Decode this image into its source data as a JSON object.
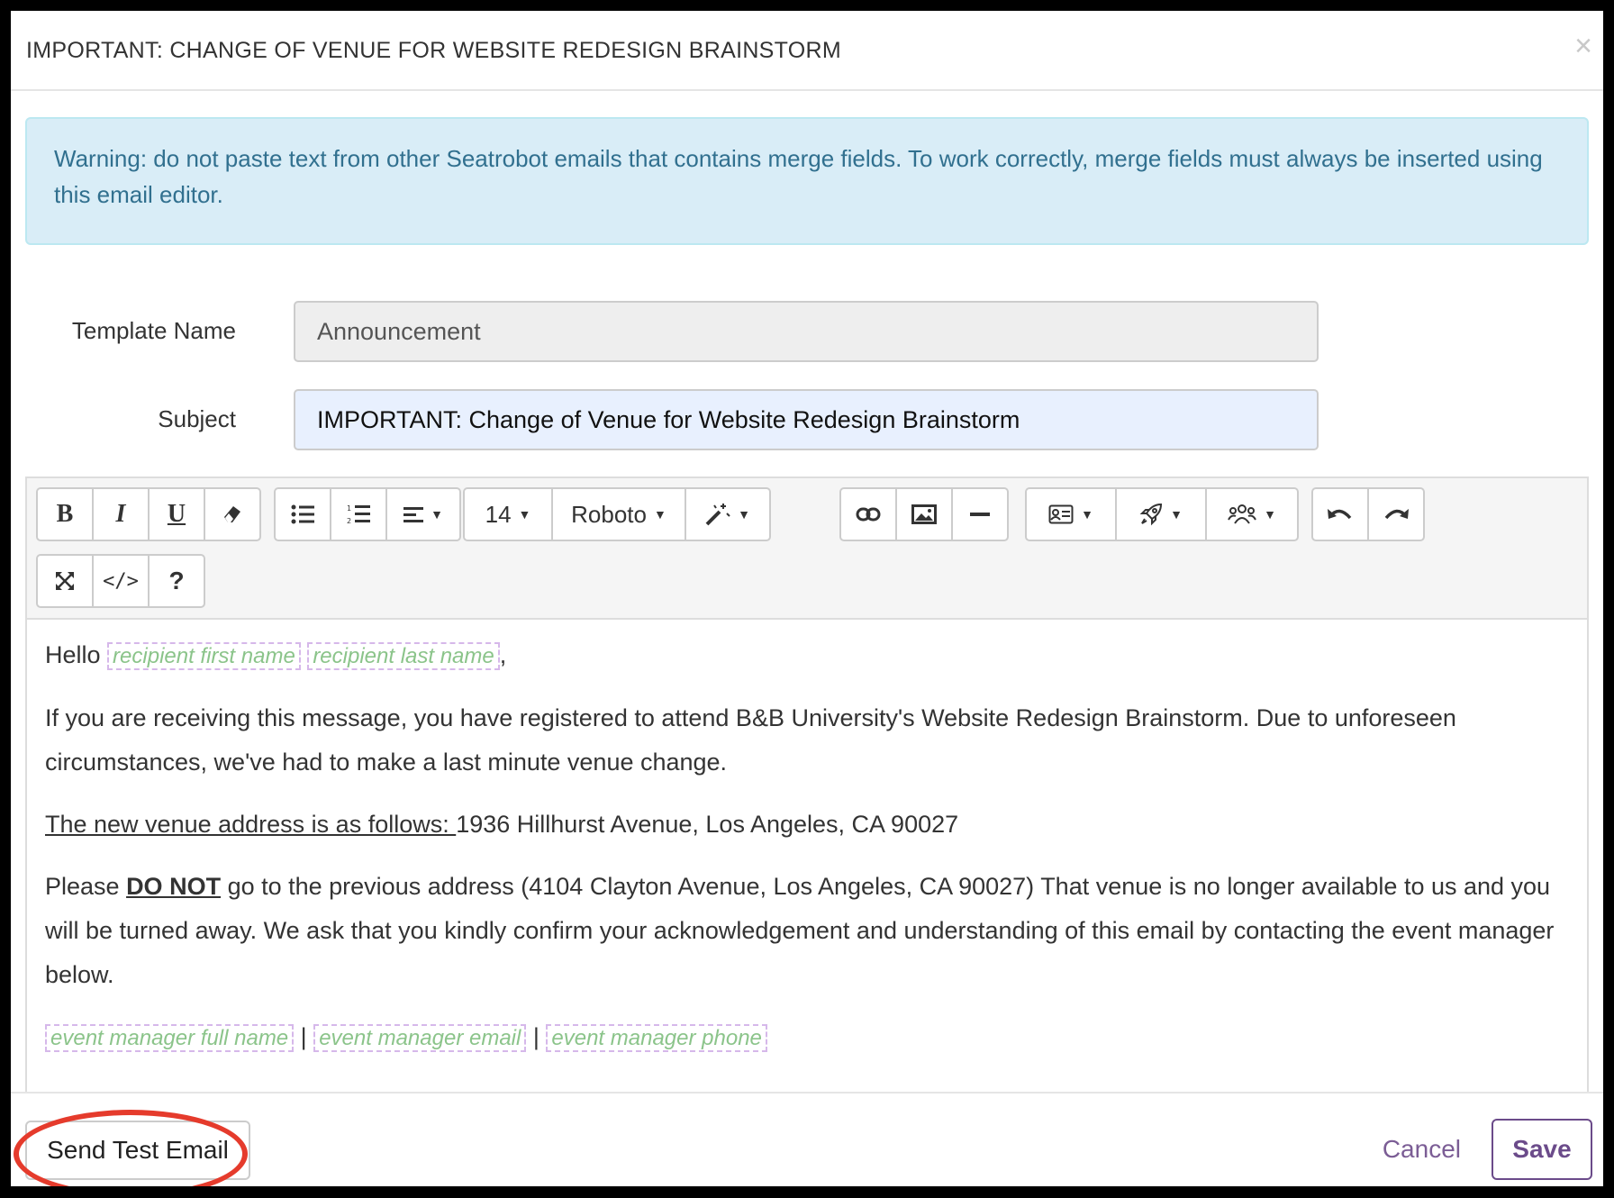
{
  "modal": {
    "title": "IMPORTANT: CHANGE OF VENUE FOR WEBSITE REDESIGN BRAINSTORM",
    "close_icon": "×"
  },
  "alert": {
    "text": "Warning: do not paste text from other Seatrobot emails that contains merge fields. To work correctly, merge fields must always be inserted using this email editor."
  },
  "form": {
    "template_label": "Template Name",
    "template_value": "Announcement",
    "subject_label": "Subject",
    "subject_value": "IMPORTANT: Change of Venue for Website Redesign Brainstorm"
  },
  "toolbar": {
    "font_size": "14",
    "font_family": "Roboto",
    "help": "?",
    "icons": [
      "bold-icon",
      "italic-icon",
      "underline-icon",
      "eraser-icon",
      "unordered-list-icon",
      "ordered-list-icon",
      "align-icon",
      "magic-wand-icon",
      "link-icon",
      "image-icon",
      "horizontal-rule-icon",
      "contact-card-icon",
      "rocket-icon",
      "people-icon",
      "undo-icon",
      "redo-icon",
      "fullscreen-icon",
      "code-view-icon",
      "help-icon"
    ]
  },
  "body": {
    "greeting": "Hello",
    "merge_first": "recipient first name",
    "merge_last": "recipient last name",
    "comma": ",",
    "para1": "If you are receiving this message, you have registered to attend B&B University's Website Redesign Brainstorm. Due to unforeseen circumstances, we've had to make a last minute venue change.",
    "address_label": "The new venue address is as follows: ",
    "address": "1936 Hillhurst Avenue, Los Angeles, CA 90027",
    "para3_start": "Please ",
    "para3_bold": "DO NOT",
    "para3_end": " go to the previous address (4104 Clayton Avenue, Los Angeles, CA 90027) That venue is no longer available to us and you will be turned away. We ask that you kindly confirm your acknowledgement and understanding of this email by contacting the event manager below.",
    "merge_mgr_name": "event manager full name",
    "merge_mgr_email": "event manager email",
    "merge_mgr_phone": "event manager phone",
    "separator": "|"
  },
  "footer": {
    "send_test": "Send Test Email",
    "cancel": "Cancel",
    "save": "Save"
  },
  "colors": {
    "alert_bg": "#d9edf7",
    "alert_text": "#31708f",
    "merge_text": "#8bc48a",
    "accent": "#6b4b8a",
    "highlight": "#e53b2c"
  }
}
